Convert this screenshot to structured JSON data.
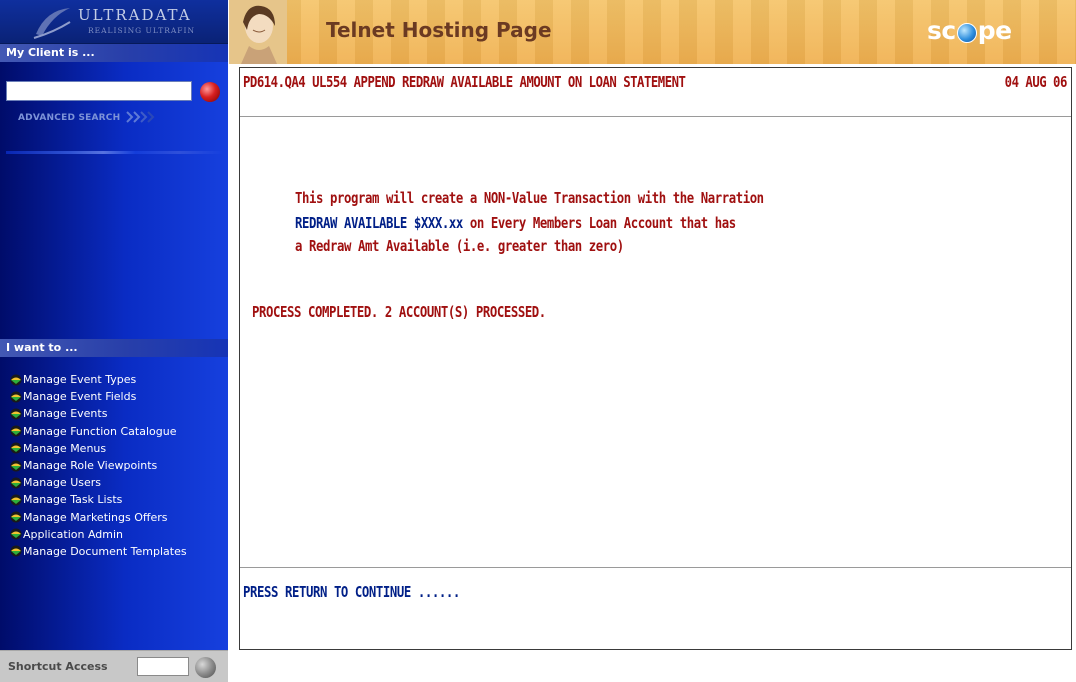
{
  "branding": {
    "logo_name": "ULTRADATA",
    "logo_tagline": "REALISING ULTRAFIN",
    "banner_title": "Telnet Hosting Page",
    "scope_logo": {
      "before": "sc",
      "after": "pe"
    }
  },
  "sidebar": {
    "client_header": "My Client is ...",
    "client_input": {
      "value": "",
      "placeholder": ""
    },
    "advanced_search": "ADVANCED SEARCH",
    "want_header": "I want to ...",
    "menu_items": [
      {
        "label": "Manage Event Types"
      },
      {
        "label": "Manage Event Fields"
      },
      {
        "label": "Manage Events"
      },
      {
        "label": "Manage Function Catalogue"
      },
      {
        "label": "Manage Menus"
      },
      {
        "label": "Manage Role Viewpoints"
      },
      {
        "label": "Manage Users"
      },
      {
        "label": "Manage Task Lists"
      },
      {
        "label": "Manage Marketings Offers"
      },
      {
        "label": "Application Admin"
      },
      {
        "label": "Manage Document Templates"
      }
    ],
    "shortcut": {
      "label": "Shortcut Access",
      "value": ""
    }
  },
  "terminal": {
    "title": "PD614.QA4 UL554 APPEND REDRAW AVAILABLE AMOUNT ON LOAN STATEMENT",
    "date": "04 AUG 06",
    "message": {
      "line1": "This program will create a NON-Value Transaction with the Narration",
      "line2_highlight": "REDRAW AVAILABLE $XXX.xx",
      "line2_rest": " on Every Members Loan Account that has",
      "line3": "a Redraw Amt Available (i.e. greater than zero)"
    },
    "process_status": "PROCESS COMPLETED. 2 ACCOUNT(S) PROCESSED.",
    "prompt": "PRESS RETURN TO CONTINUE ......"
  },
  "colors": {
    "sidebar_dark": "#000c6a",
    "sidebar_blue": "#1640de",
    "banner_orange": "#f0b04f",
    "banner_title": "#6b3a22",
    "terminal_red": "#a01010",
    "terminal_blue": "#001f87"
  },
  "icons": {
    "menu_bullet": "arrow-bullet-icon",
    "client_go": "red-go-button-icon",
    "shortcut_go": "magnifier-icon",
    "advanced_search_arrows": "double-chevron-right-icon"
  }
}
